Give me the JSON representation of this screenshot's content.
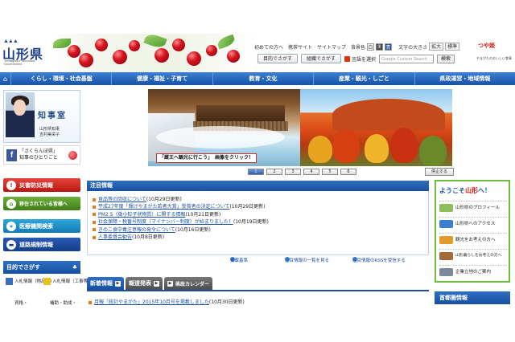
{
  "header": {
    "logo_mark": "▲▲▲",
    "site_name": "山形県",
    "site_name_en": "Yamagata Prefectural Government",
    "util_links": [
      "初めての方へ",
      "携帯サイト",
      "サイトマップ"
    ],
    "bg_color_label": "背景色",
    "bg_swatches": [
      "白",
      "黒",
      "青"
    ],
    "text_size_label": "文字の大きさ",
    "enlarge": "拡大",
    "standard": "標準",
    "tsuyahime_logo": "つや姫",
    "tsuyahime_sub": "やまがたのおいしい食事",
    "find_by_purpose": "目的でさがす",
    "find_by_org": "組織でさがす",
    "language": "言語を選択",
    "search_placeholder": "Google Custom Search",
    "search_button": "検索"
  },
  "nav": {
    "items": [
      "くらし・環境・社会基盤",
      "健康・福祉・子育て",
      "教育・文化",
      "産業・観光・しごと",
      "県政運営・地域情報"
    ]
  },
  "governor": {
    "title": "知事室",
    "line1": "山形県知事",
    "line2": "吉村美栄子"
  },
  "facebook": {
    "line1": "「さくらんぼ県」",
    "line2": "知事のひとりごと"
  },
  "left_buttons": {
    "disaster": "災害防災情報",
    "relocation": "移住されている皆様へ",
    "medical": "医療機関検索",
    "road": "道路規制情報"
  },
  "purpose": {
    "header": "目的でさがす",
    "items": [
      "入札情報（物品等）",
      "入札情報（工事等）",
      "資格・",
      "補助・助成・"
    ]
  },
  "banner": {
    "caption": "「蔵王へ観光に行こう」　画像をクリック！",
    "pages": [
      "1",
      "2",
      "3",
      "4",
      "5",
      "6"
    ],
    "stop": "停止する"
  },
  "notices": {
    "header": "注目情報",
    "items": [
      {
        "title": "食品等の回収について",
        "date": "(10月29日更新)"
      },
      {
        "title": "平成27年度「輝けやまがた若者大賞」受賞者の決定について",
        "date": "(10月29日更新)"
      },
      {
        "title": "PM2.5（微小粒子状物質）に関する情報",
        "date": "(10月21日更新)"
      },
      {
        "title": "社会保障・税番号制度（マイナンバー制度）が始まりました！",
        "date": "(10月19日更新)"
      },
      {
        "title": "きのこ食中毒注意報の発令について",
        "date": "(10月16日更新)"
      },
      {
        "title": "人事委員会勧告",
        "date": "(10月8日更新)"
      }
    ],
    "footer": {
      "criteria": "掲載基準",
      "list": "注目情報の一覧を見る",
      "rss": "注目情報のRSSを受信する"
    }
  },
  "tabs": {
    "items": [
      "新着情報",
      "報道発表",
      "県政カレンダー"
    ]
  },
  "news": {
    "title": "月報「統計やまがた」2015年10月号を掲載しました",
    "date": "(10月30日更新)"
  },
  "welcome": {
    "prefix": "ようこそ",
    "brand": "山形",
    "suffix": "へ！",
    "items": [
      "山形県のプロフィール",
      "山形県へのアクセス",
      "観光をお考えの方へ",
      "山形暮らしをお考えの方へ",
      "企業立地のご案内"
    ]
  },
  "metro": {
    "header": "首都圏情報"
  }
}
